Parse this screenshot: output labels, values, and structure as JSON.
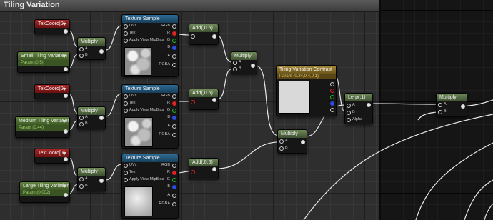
{
  "window": {
    "title": "Tiling Variation"
  },
  "nodes": {
    "texcoord_1": {
      "title": "TexCoord[0]"
    },
    "texcoord_2": {
      "title": "TexCoord[0]"
    },
    "texcoord_3": {
      "title": "TexCoord[0]"
    },
    "param_small": {
      "title": "Small Tiling Variation",
      "sub": "Param (0.5)"
    },
    "param_medium": {
      "title": "Medium Tiling Variation",
      "sub": "Param (0.44)"
    },
    "param_large": {
      "title": "Large Tiling Variation",
      "sub": "Param (0.002)"
    },
    "multiply_1": {
      "title": "Multiply",
      "pin_a": "A",
      "pin_b": "B"
    },
    "multiply_2": {
      "title": "Multiply",
      "pin_a": "A",
      "pin_b": "B"
    },
    "multiply_3": {
      "title": "Multiply",
      "pin_a": "A",
      "pin_b": "B"
    },
    "texsample_1": {
      "title": "Texture Sample",
      "uvs": "UVs",
      "tex": "Tex",
      "bias": "Apply View MipBias",
      "rgb": "RGB",
      "r": "R",
      "g": "G",
      "b": "B",
      "a": "A",
      "rgba": "RGBA"
    },
    "texsample_2": {
      "title": "Texture Sample",
      "uvs": "UVs",
      "tex": "Tex",
      "bias": "Apply View MipBias",
      "rgb": "RGB",
      "r": "R",
      "g": "G",
      "b": "B",
      "a": "A",
      "rgba": "RGBA"
    },
    "texsample_3": {
      "title": "Texture Sample",
      "uvs": "UVs",
      "tex": "Tex",
      "bias": "Apply View MipBias",
      "rgb": "RGB",
      "r": "R",
      "g": "G",
      "b": "B",
      "a": "A",
      "rgba": "RGBA"
    },
    "add_1": {
      "title": "Add(,0.5)"
    },
    "add_2": {
      "title": "Add(,0.5)"
    },
    "add_3": {
      "title": "Add(,0.5)"
    },
    "multiply_4": {
      "title": "Multiply",
      "pin_a": "A",
      "pin_b": "B"
    },
    "multiply_5": {
      "title": "Multiply",
      "pin_a": "A",
      "pin_b": "B"
    },
    "contrast": {
      "title": "Tiling Variation Contrast",
      "sub": "Param (0.84,0.4,0.1)"
    },
    "lerp": {
      "title": "Lerp(,1)",
      "pin_a": "A",
      "pin_b": "B",
      "pin_alpha": "Alpha"
    },
    "multiply_6": {
      "title": "Multiply",
      "pin_a": "A",
      "pin_b": "B"
    }
  },
  "colors": {
    "pin_red": "#e02222",
    "pin_green": "#22c022",
    "pin_blue": "#2a4ae0",
    "wire": "#e8e8e8"
  },
  "icons": [
    "dropdown-arrow-icon",
    "output-pin-icon",
    "input-pin-icon"
  ]
}
